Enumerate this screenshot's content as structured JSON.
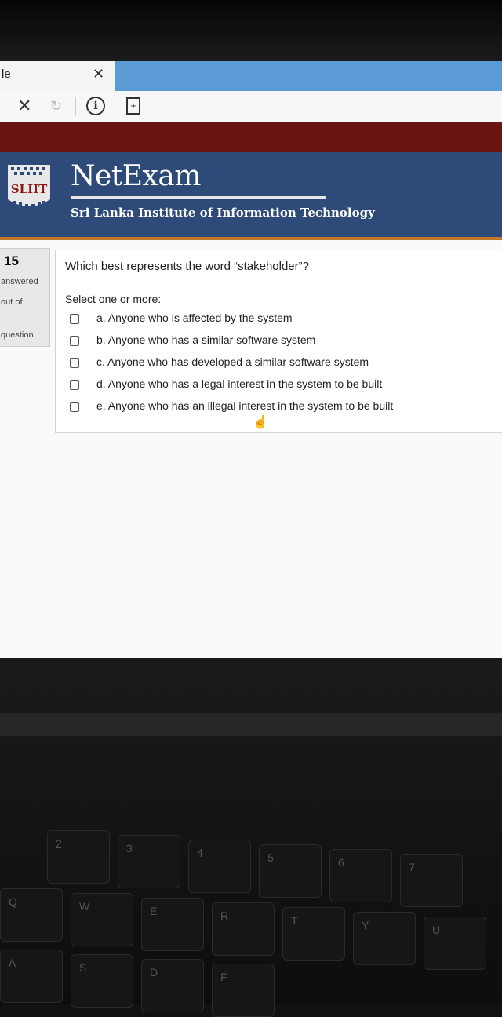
{
  "browser": {
    "tab_title": "le",
    "tab_close": "✕"
  },
  "nav": {
    "stop": "✕",
    "reload": "↻",
    "info": "i",
    "page_action": "+"
  },
  "brand": {
    "logo_text": "SLIIT",
    "title": "NetExam",
    "subtitle": "Sri Lanka Institute of Information Technology"
  },
  "question_info": {
    "number": "15",
    "state": "answered",
    "grade": "out of",
    "flag": "question"
  },
  "question": {
    "text": "Which best represents the word “stakeholder”?",
    "prompt": "Select one or more:",
    "options": [
      "a. Anyone who is affected by the system",
      "b. Anyone who has a similar software system",
      "c. Anyone who has developed a similar software system",
      "d. Anyone who has a legal interest in the system to be built",
      "e. Anyone who has an illegal interest in the system to be built"
    ]
  },
  "keyboard": {
    "keys": [
      "Q",
      "W",
      "E",
      "R",
      "T",
      "Y",
      "U",
      "A",
      "S",
      "D",
      "F",
      "2",
      "3",
      "4",
      "5",
      "6",
      "7"
    ]
  },
  "colors": {
    "header_blue": "#2e4a78",
    "red_bar": "#6b1414",
    "accent_orange": "#c4782d",
    "tab_blue": "#5b9bd5"
  }
}
